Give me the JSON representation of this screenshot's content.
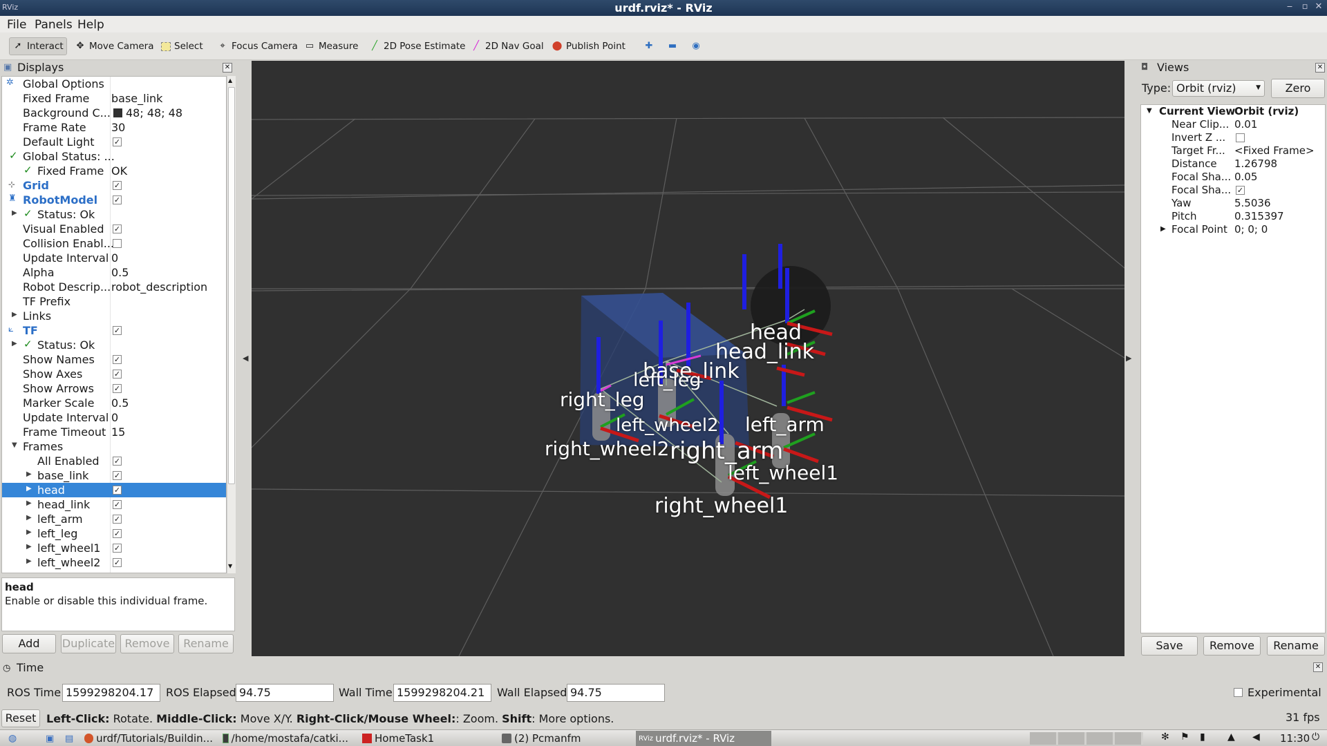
{
  "window": {
    "title": "urdf.rviz* - RViz",
    "app_icon": "RViz"
  },
  "menu": [
    "File",
    "Panels",
    "Help"
  ],
  "toolbar": {
    "tools": [
      {
        "label": "Interact",
        "icon": "cursor-icon"
      },
      {
        "label": "Move Camera",
        "icon": "move-camera-icon"
      },
      {
        "label": "Select",
        "icon": "select-icon"
      },
      {
        "label": "Focus Camera",
        "icon": "focus-camera-icon"
      },
      {
        "label": "Measure",
        "icon": "measure-icon"
      },
      {
        "label": "2D Pose Estimate",
        "icon": "pose-estimate-icon"
      },
      {
        "label": "2D Nav Goal",
        "icon": "nav-goal-icon"
      },
      {
        "label": "Publish Point",
        "icon": "publish-point-icon"
      }
    ]
  },
  "displays": {
    "title": "Displays",
    "rows": [
      {
        "name": "Global Options",
        "value": ""
      },
      {
        "name": "Fixed Frame",
        "value": "base_link"
      },
      {
        "name": "Background C...",
        "value": "48; 48; 48"
      },
      {
        "name": "Frame Rate",
        "value": "30"
      },
      {
        "name": "Default Light",
        "value": ""
      },
      {
        "name": "Global Status: ...",
        "value": ""
      },
      {
        "name": "Fixed Frame",
        "value": "OK"
      },
      {
        "name": "Grid",
        "value": ""
      },
      {
        "name": "RobotModel",
        "value": ""
      },
      {
        "name": "Status: Ok",
        "value": ""
      },
      {
        "name": "Visual Enabled",
        "value": ""
      },
      {
        "name": "Collision Enabl...",
        "value": ""
      },
      {
        "name": "Update Interval",
        "value": "0"
      },
      {
        "name": "Alpha",
        "value": "0.5"
      },
      {
        "name": "Robot Descrip...",
        "value": "robot_description"
      },
      {
        "name": "TF Prefix",
        "value": ""
      },
      {
        "name": "Links",
        "value": ""
      },
      {
        "name": "TF",
        "value": ""
      },
      {
        "name": "Status: Ok",
        "value": ""
      },
      {
        "name": "Show Names",
        "value": ""
      },
      {
        "name": "Show Axes",
        "value": ""
      },
      {
        "name": "Show Arrows",
        "value": ""
      },
      {
        "name": "Marker Scale",
        "value": "0.5"
      },
      {
        "name": "Update Interval",
        "value": "0"
      },
      {
        "name": "Frame Timeout",
        "value": "15"
      },
      {
        "name": "Frames",
        "value": ""
      },
      {
        "name": "All Enabled",
        "value": ""
      },
      {
        "name": "base_link",
        "value": ""
      },
      {
        "name": "head",
        "value": ""
      },
      {
        "name": "head_link",
        "value": ""
      },
      {
        "name": "left_arm",
        "value": ""
      },
      {
        "name": "left_leg",
        "value": ""
      },
      {
        "name": "left_wheel1",
        "value": ""
      },
      {
        "name": "left_wheel2",
        "value": ""
      }
    ],
    "description_title": "head",
    "description_text": "Enable or disable this individual frame.",
    "buttons": [
      "Add",
      "Duplicate",
      "Remove",
      "Rename"
    ],
    "background_color": "#303030"
  },
  "viewport_labels": [
    "head",
    "head_link",
    "base_link",
    "left_leg",
    "right_leg",
    "left_wheel2",
    "left_arm",
    "right_wheel2",
    "right_arm",
    "left_wheel1",
    "right_wheel1"
  ],
  "views": {
    "title": "Views",
    "type_label": "Type:",
    "type_value": "Orbit (rviz)",
    "zero_label": "Zero",
    "rows": [
      {
        "name": "Current View",
        "value": "Orbit (rviz)"
      },
      {
        "name": "Near Clip...",
        "value": "0.01"
      },
      {
        "name": "Invert Z ...",
        "value": ""
      },
      {
        "name": "Target Fr...",
        "value": "<Fixed Frame>"
      },
      {
        "name": "Distance",
        "value": "1.26798"
      },
      {
        "name": "Focal Sha...",
        "value": "0.05"
      },
      {
        "name": "Focal Sha...",
        "value": ""
      },
      {
        "name": "Yaw",
        "value": "5.5036"
      },
      {
        "name": "Pitch",
        "value": "0.315397"
      },
      {
        "name": "Focal Point",
        "value": "0; 0; 0"
      }
    ],
    "buttons": [
      "Save",
      "Remove",
      "Rename"
    ]
  },
  "time": {
    "title": "Time",
    "ros_time_label": "ROS Time:",
    "ros_time": "1599298204.17",
    "ros_elapsed_label": "ROS Elapsed:",
    "ros_elapsed": "94.75",
    "wall_time_label": "Wall Time:",
    "wall_time": "1599298204.21",
    "wall_elapsed_label": "Wall Elapsed:",
    "wall_elapsed": "94.75",
    "experimental_label": "Experimental"
  },
  "status": {
    "reset_label": "Reset",
    "hint_b1": "Left-Click:",
    "hint_t1": " Rotate. ",
    "hint_b2": "Middle-Click:",
    "hint_t2": " Move X/Y. ",
    "hint_b3": "Right-Click/Mouse Wheel:",
    "hint_t3": ": Zoom. ",
    "hint_b4": "Shift",
    "hint_t4": ": More options.",
    "fps": "31 fps"
  },
  "taskbar": {
    "tasks": [
      "urdf/Tutorials/Buildin...",
      "/home/mostafa/catki...",
      "HomeTask1",
      "(2) Pcmanfm",
      "urdf.rviz* - RViz"
    ],
    "clock": "11:30"
  }
}
